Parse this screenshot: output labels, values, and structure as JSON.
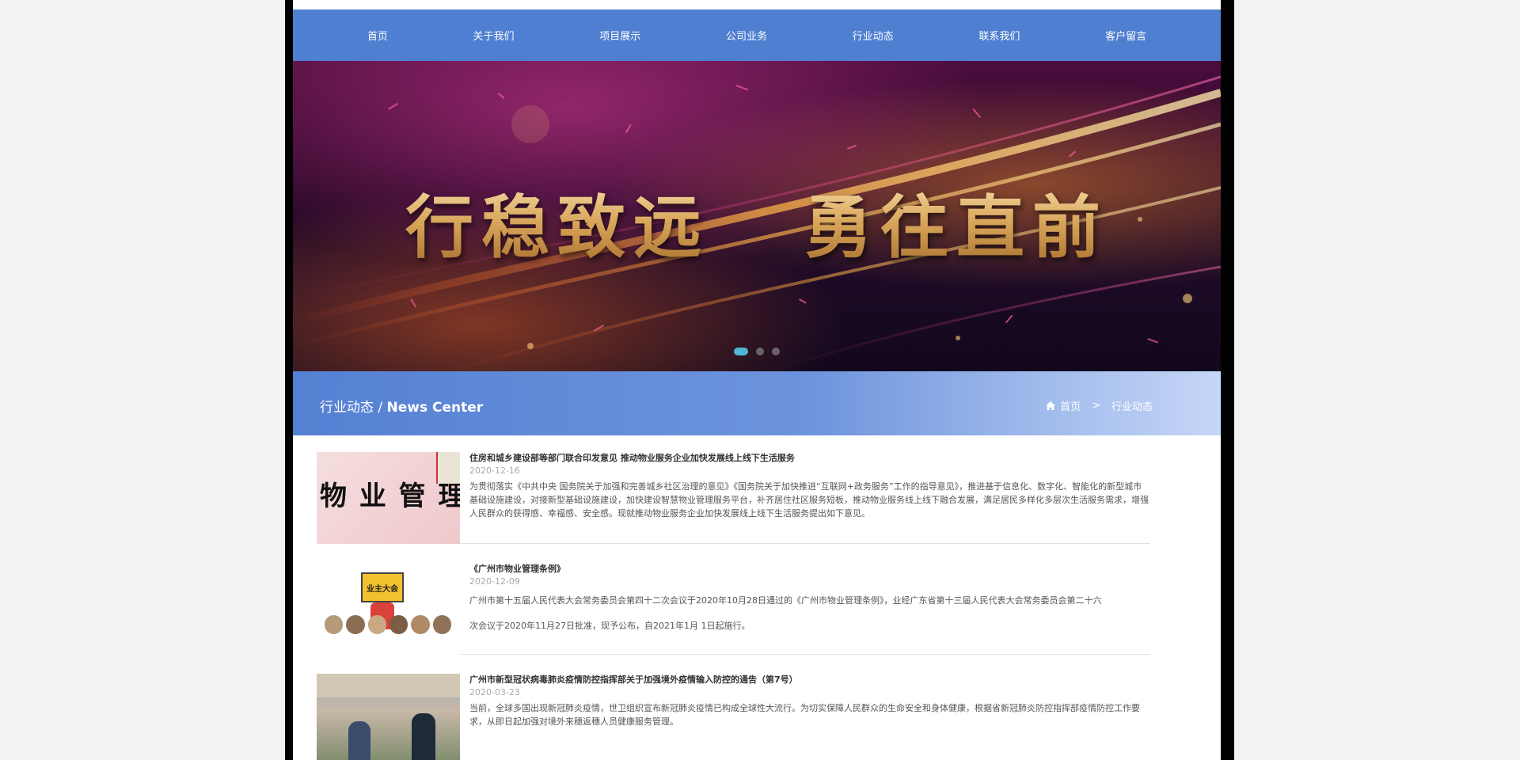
{
  "nav": {
    "items": [
      {
        "label": "首页"
      },
      {
        "label": "关于我们"
      },
      {
        "label": "项目展示"
      },
      {
        "label": "公司业务"
      },
      {
        "label": "行业动态"
      },
      {
        "label": "联系我们"
      },
      {
        "label": "客户留言"
      }
    ]
  },
  "banner": {
    "text_left": "行稳致远",
    "text_right": "勇往直前",
    "slides": 3,
    "active_slide": 1
  },
  "section": {
    "title_cn": "行业动态",
    "title_sep": " / ",
    "title_en": "News Center",
    "breadcrumb": {
      "home": "首页",
      "separator": ">",
      "current": "行业动态"
    }
  },
  "news": [
    {
      "title": "住房和城乡建设部等部门联合印发意见 推动物业服务企业加快发展线上线下生活服务",
      "date": "2020-12-16",
      "summary": "为贯彻落实《中共中央 国务院关于加强和完善城乡社区治理的意见》《国务院关于加快推进“互联网+政务服务”工作的指导意见》，推进基于信息化、数字化、智能化的新型城市基础设施建设，对接新型基础设施建设，加快建设智慧物业管理服务平台，补齐居住社区服务短板，推动物业服务线上线下融合发展，满足居民多样化多层次生活服务需求，增强人民群众的获得感、幸福感、安全感。现就推动物业服务企业加快发展线上线下生活服务提出如下意见。",
      "thumb_text": "物 业 管 理"
    },
    {
      "title": "《广州市物业管理条例》",
      "date": "2020-12-09",
      "summary_line1": "广州市第十五届人民代表大会常务委员会第四十二次会议于2020年10月28日通过的《广州市物业管理条例》，业经广东省第十三届人民代表大会常务委员会第二十六",
      "summary_line2": "次会议于2020年11月27日批准，现予公布，自2021年1月 1日起施行。",
      "thumb_text": "业主大会"
    },
    {
      "title": "广州市新型冠状病毒肺炎疫情防控指挥部关于加强境外疫情输入防控的通告（第7号）",
      "date": "2020-03-23",
      "summary": "当前，全球多国出现新冠肺炎疫情，世卫组织宣布新冠肺炎疫情已构成全球性大流行。为切实保障人民群众的生命安全和身体健康，根据省新冠肺炎防控指挥部疫情防控工作要求，从即日起加强对境外来穗返穗人员健康服务管理。"
    }
  ],
  "colors": {
    "nav_bg": "#4f7fd1",
    "active_dot": "#4fb6d6",
    "banner_gold": "#e6c48a"
  }
}
